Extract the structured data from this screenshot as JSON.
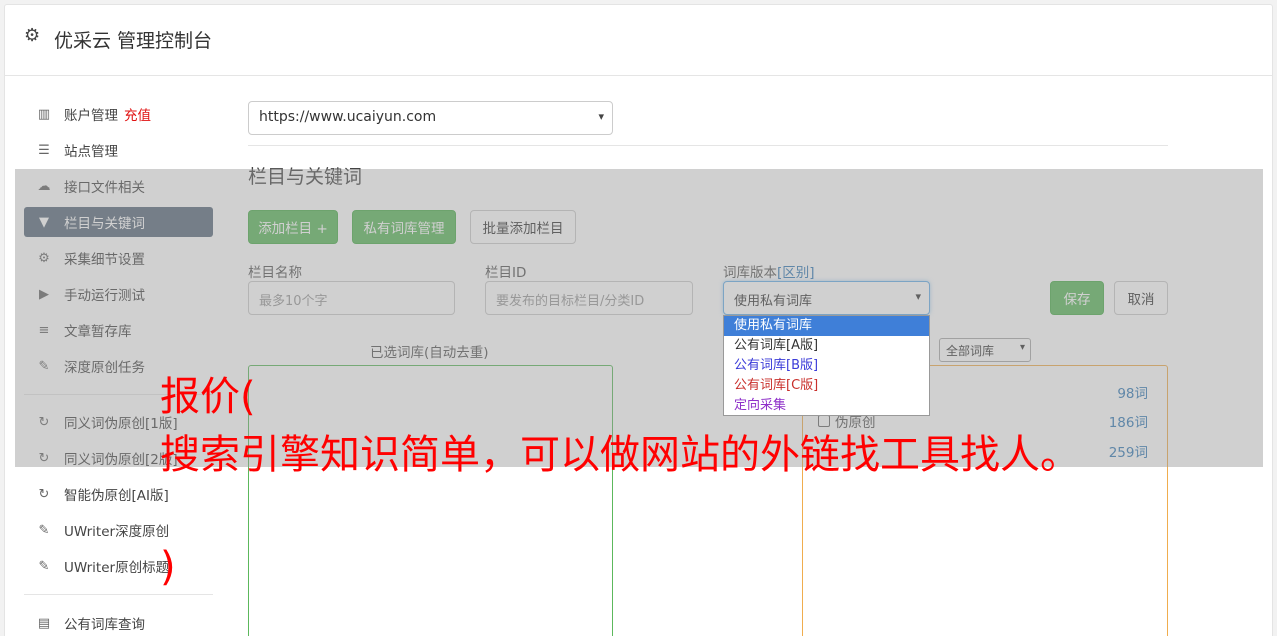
{
  "header": {
    "title": "优采云 管理控制台",
    "icon": "gear-icon"
  },
  "sidebar": {
    "items": [
      {
        "label": "账户管理",
        "extra": "充值",
        "icon": "bar-chart-icon"
      },
      {
        "label": "站点管理",
        "icon": "server-icon"
      },
      {
        "label": "接口文件相关",
        "icon": "cloud-upload-icon"
      },
      {
        "label": "栏目与关键词",
        "icon": "filter-icon",
        "active": true
      },
      {
        "label": "采集细节设置",
        "icon": "cogs-icon"
      },
      {
        "label": "手动运行测试",
        "icon": "play-circle-icon"
      },
      {
        "label": "文章暂存库",
        "icon": "database-icon"
      },
      {
        "label": "深度原创任务",
        "icon": "edit-icon"
      },
      {
        "label": "同义词伪原创[1版]",
        "icon": "refresh-icon"
      },
      {
        "label": "同义词伪原创[2版]",
        "icon": "refresh-icon"
      },
      {
        "label": "智能伪原创[AI版]",
        "icon": "refresh-icon"
      },
      {
        "label": "UWriter深度原创",
        "icon": "edit-icon"
      },
      {
        "label": "UWriter原创标题",
        "icon": "edit-icon"
      },
      {
        "label": "公有词库查询",
        "icon": "book-icon"
      }
    ]
  },
  "main": {
    "site_select_value": "https://www.ucaiyun.com",
    "section_title": "栏目与关键词",
    "buttons": {
      "add_column": "添加栏目 +",
      "private_lib": "私有词库管理",
      "batch_add": "批量添加栏目",
      "save": "保存",
      "cancel": "取消"
    },
    "fields": {
      "column_name_label": "栏目名称",
      "column_name_placeholder": "最多10个字",
      "column_id_label": "栏目ID",
      "column_id_placeholder": "要发布的目标栏目/分类ID",
      "lib_version_label": "词库版本",
      "lib_version_link": "[区别]",
      "lib_version_value": "使用私有词库"
    },
    "dropdown_options": [
      {
        "label": "使用私有词库",
        "color": "#ffffff"
      },
      {
        "label": "公有词库[A版]",
        "color": "#333333"
      },
      {
        "label": "公有词库[B版]",
        "color": "#3b3bd8"
      },
      {
        "label": "公有词库[C版]",
        "color": "#c9302c"
      },
      {
        "label": "定向采集",
        "color": "#8e2fc9"
      }
    ],
    "selected_lib_label": "已选词库(自动去重)",
    "filter_select_value": "全部词库",
    "libraries": [
      {
        "name": "",
        "count": "98词"
      },
      {
        "name": "伪原创",
        "count": "186词"
      },
      {
        "name": "",
        "count": "259词"
      }
    ]
  },
  "overlay_text": {
    "line1": "报价(",
    "line2": "搜索引擎知识简单，可以做网站的外链找工具找人。",
    "line3": ")"
  }
}
